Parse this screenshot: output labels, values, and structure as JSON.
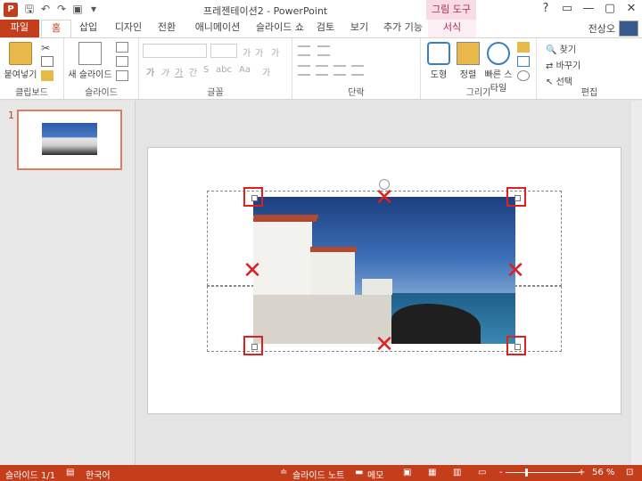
{
  "app": {
    "icon": "P",
    "title": "프레젠테이션2 - PowerPoint",
    "context_title": "그림 도구"
  },
  "qat": {
    "icons": [
      "save-icon",
      "undo-icon",
      "redo-icon",
      "slideshow-icon",
      "customize-icon"
    ]
  },
  "window_controls": [
    "?",
    "▭",
    "—",
    "▢",
    "✕"
  ],
  "tabs": [
    "파일",
    "홈",
    "삽입",
    "디자인",
    "전환",
    "애니메이션",
    "슬라이드 쇼",
    "검토",
    "보기",
    "추가 기능",
    "서식"
  ],
  "user": "전상오",
  "ribbon": {
    "clipboard": {
      "paste": "붙여넣기",
      "label": "클립보드"
    },
    "slides": {
      "new_slide": "새 슬라이드",
      "label": "슬라이드"
    },
    "font": {
      "label": "글꼴",
      "buttons": [
        "가",
        "가",
        "가",
        "간",
        "S",
        "abc",
        "Aa",
        "가"
      ],
      "size_buttons": [
        "가",
        "가",
        "가"
      ]
    },
    "paragraph": {
      "label": "단락"
    },
    "drawing": {
      "shapes": "도형",
      "arrange": "정렬",
      "quick_styles": "빠른 스타일",
      "label": "그리기"
    },
    "editing": {
      "find": "찾기",
      "replace": "바꾸기",
      "select": "선택",
      "label": "편집"
    }
  },
  "thumbnails": {
    "slide_number": "1"
  },
  "status": {
    "slide": "슬라이드 1/1",
    "language": "한국어",
    "notes": "슬라이드 노트",
    "comments": "메모",
    "zoom_minus": "-",
    "zoom_plus": "+",
    "zoom": "56 %"
  },
  "accent": "#c43e1c",
  "context_accent": "#b3265a"
}
